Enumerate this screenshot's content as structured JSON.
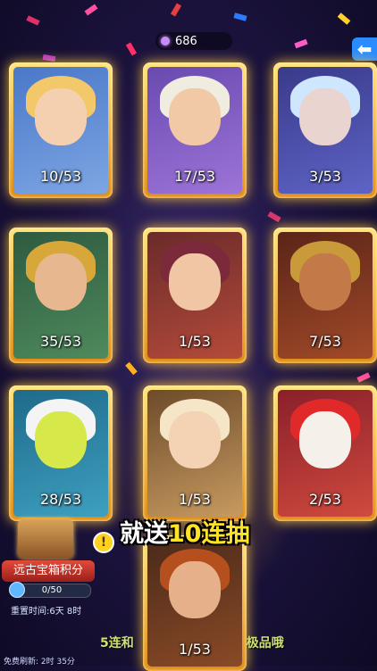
{
  "header": {
    "currency_value": "686"
  },
  "cards": [
    {
      "count": "10/53",
      "icon": "hero-blonde-mage"
    },
    {
      "count": "17/53",
      "icon": "hero-bearded-sage"
    },
    {
      "count": "3/53",
      "icon": "hero-ice-warrior"
    },
    {
      "count": "35/53",
      "icon": "hero-pharaoh-queen"
    },
    {
      "count": "1/53",
      "icon": "hero-headband-fighter"
    },
    {
      "count": "7/53",
      "icon": "hero-monkey-king"
    },
    {
      "count": "28/53",
      "icon": "hero-masked-ninja"
    },
    {
      "count": "1/53",
      "icon": "hero-golden-priestess"
    },
    {
      "count": "2/53",
      "icon": "hero-santa"
    },
    {
      "count": "1/53",
      "icon": "hero-red-bearded-king"
    }
  ],
  "banner": {
    "prefix": "就送",
    "highlight": "10连抽"
  },
  "chest_panel": {
    "title": "远古宝箱积分",
    "progress": "0/50",
    "reset_time": "重置时间:6天 8时"
  },
  "footer": {
    "free_refresh": "免费刷新: 2时 35分",
    "promo_left": "5连和",
    "promo_right": "极品哦"
  },
  "colors": {
    "card_frame": "#f0b030",
    "banner_highlight": "#ffe326",
    "back_button": "#2a8cff"
  }
}
